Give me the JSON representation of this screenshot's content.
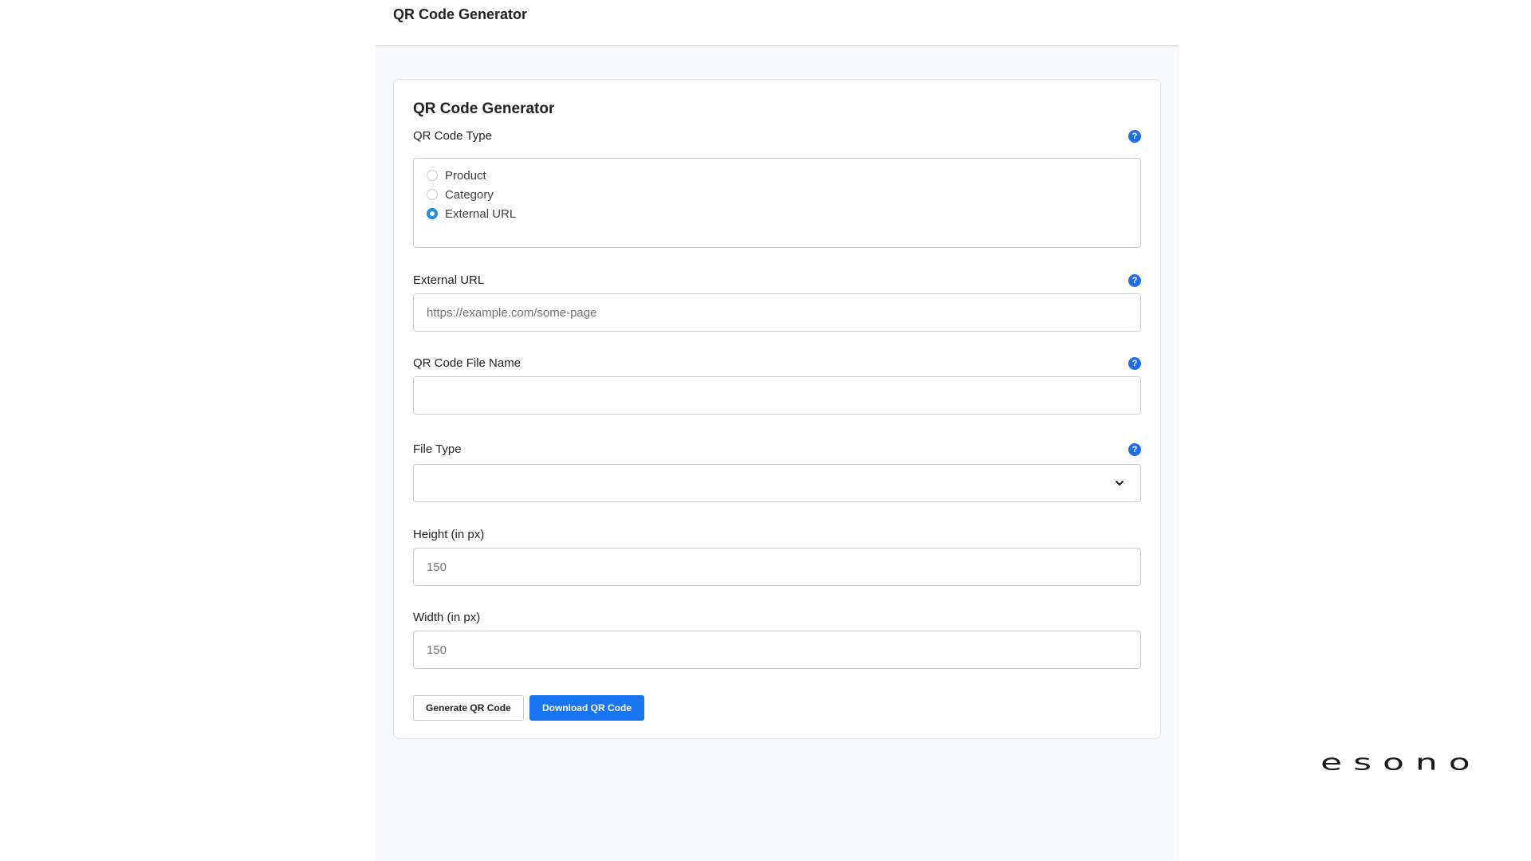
{
  "app": {
    "title": "QR Code Generator"
  },
  "card": {
    "title": "QR Code Generator"
  },
  "qr_type": {
    "label": "QR Code Type",
    "options": [
      {
        "label": "Product",
        "selected": false
      },
      {
        "label": "Category",
        "selected": false
      },
      {
        "label": "External URL",
        "selected": true
      }
    ]
  },
  "external_url": {
    "label": "External URL",
    "placeholder": "https://example.com/some-page",
    "value": ""
  },
  "file_name": {
    "label": "QR Code File Name",
    "value": ""
  },
  "file_type": {
    "label": "File Type",
    "value": ""
  },
  "height": {
    "label": "Height (in px)",
    "placeholder": "150"
  },
  "width": {
    "label": "Width (in px)",
    "placeholder": "150"
  },
  "actions": {
    "generate_label": "Generate QR Code",
    "download_label": "Download QR Code"
  },
  "help_icon_glyph": "?",
  "brand": {
    "logo_text": "esono"
  },
  "colors": {
    "accent": "#1874f0",
    "help_icon": "#1f6feb",
    "radio_selected": "#1f8fe0",
    "frame_background": "#f6f8fb"
  },
  "icons": {
    "help": "question-circle-icon",
    "select": "chevron-down-icon"
  }
}
